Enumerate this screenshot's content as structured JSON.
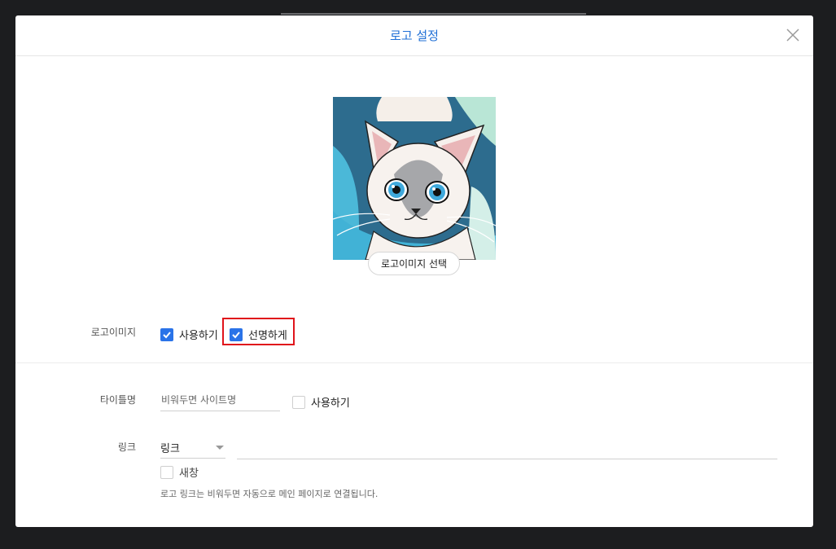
{
  "modal": {
    "title": "로고 설정"
  },
  "logo": {
    "choose_button": "로고이미지 선택"
  },
  "logo_image_row": {
    "label": "로고이미지",
    "use_checkbox": {
      "label": "사용하기",
      "checked": true
    },
    "sharp_checkbox": {
      "label": "선명하게",
      "checked": true
    }
  },
  "title_row": {
    "label": "타이틀명",
    "placeholder": "비워두면 사이트명",
    "use_checkbox": {
      "label": "사용하기",
      "checked": false
    }
  },
  "link_row": {
    "label": "링크",
    "select_value": "링크",
    "new_window_checkbox": {
      "label": "새창",
      "checked": false
    },
    "help": "로고 링크는 비워두면 자동으로 메인 페이지로 연결됩니다."
  },
  "colors": {
    "accent": "#2a73e8",
    "title": "#1f6fd6",
    "highlight": "#e0141b",
    "backdrop": "#1c1d1f"
  }
}
